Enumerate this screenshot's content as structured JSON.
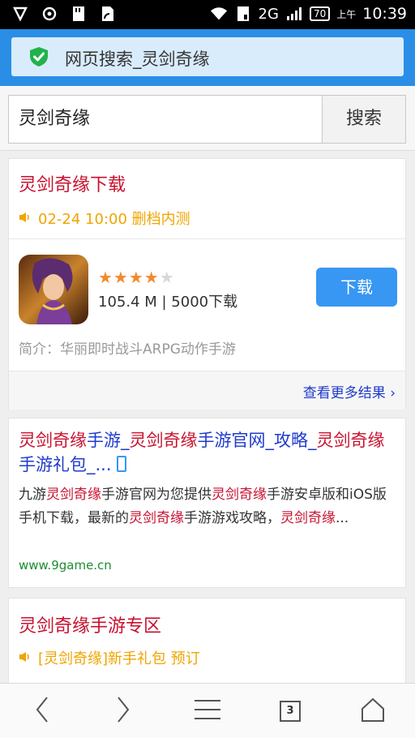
{
  "status_bar": {
    "network": "2G",
    "battery": "70",
    "ampm": "上午",
    "time": "10:39"
  },
  "address_bar": {
    "title": "网页搜索_灵剑奇缘"
  },
  "search": {
    "query": "灵剑奇缘",
    "button_label": "搜索"
  },
  "results": {
    "app_card": {
      "title": "灵剑奇缘下载",
      "notice": "02-24 10:00 删档内测",
      "rating": 4.5,
      "stars": "★★★★",
      "star_half": "★",
      "meta": "105.4 M | 5000下载",
      "download_label": "下载",
      "description": "简介：华丽即时战斗ARPG动作手游",
      "more_label": "查看更多结果 ›"
    },
    "web_result": {
      "title_parts": [
        "灵剑奇缘",
        "手游_",
        "灵剑奇缘",
        "手游官网_攻略_",
        "灵剑奇缘",
        "手游礼包_..."
      ],
      "body_parts": [
        "九游",
        "灵剑奇缘",
        "手游官网为您提供",
        "灵剑奇缘",
        "手游安卓版和iOS版手机下载，最新的",
        "灵剑奇缘",
        "手游游戏攻略，",
        "灵剑奇缘",
        "..."
      ],
      "url": "www.9game.cn"
    },
    "zone_card": {
      "title": "灵剑奇缘手游专区",
      "notice": "[灵剑奇缘]新手礼包 预订"
    }
  },
  "bottom_nav": {
    "tab_count": "3"
  },
  "colors": {
    "accent_blue": "#2a8ee6",
    "result_red": "#c8102e",
    "link_blue": "#1f3bcc",
    "notice_orange": "#f0a500",
    "url_green": "#1a8e2f",
    "button_blue": "#3797f3"
  }
}
